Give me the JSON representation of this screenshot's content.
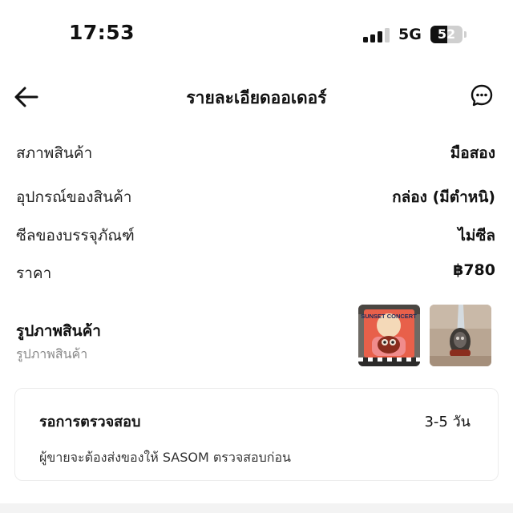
{
  "status_bar": {
    "time": "17:53",
    "network": "5G",
    "battery_percent": 52,
    "battery_text": "52"
  },
  "header": {
    "back_icon": "arrow-left-icon",
    "title": "รายละเอียดออเดอร์",
    "chat_icon": "chat-bubble-icon"
  },
  "details": [
    {
      "label": "สภาพสินค้า",
      "value": "มือสอง"
    },
    {
      "label": "อุปกรณ์ของสินค้า",
      "value": "กล่อง (มีตำหนิ)"
    },
    {
      "label": "ซีลของบรรจุภัณฑ์",
      "value": "ไม่ซีล"
    },
    {
      "label": "ราคา",
      "value": "฿780"
    }
  ],
  "photos": {
    "title": "รูปภาพสินค้า",
    "subtitle": "รูปภาพสินค้า",
    "thumbnail_1_text": "SUNSET CONCERT"
  },
  "inspection": {
    "title": "รอการตรวจสอบ",
    "duration": "3-5 วัน",
    "note": "ผู้ขายจะต้องส่งของให้ SASOM ตรวจสอบก่อน"
  }
}
